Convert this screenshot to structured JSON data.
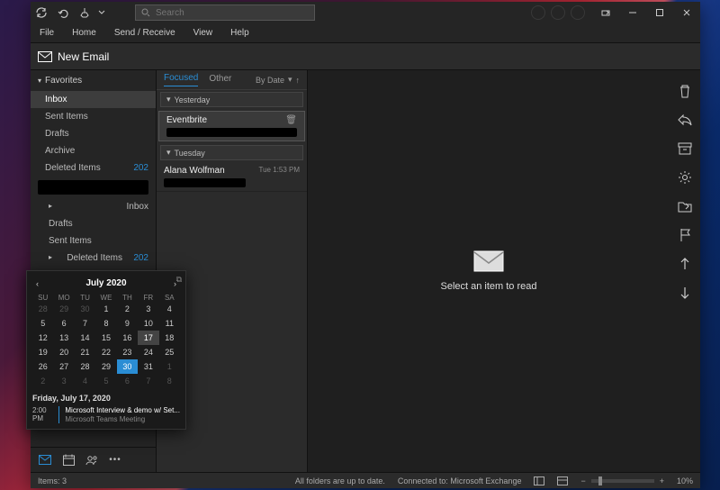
{
  "search": {
    "placeholder": "Search"
  },
  "menus": [
    "File",
    "Home",
    "Send / Receive",
    "View",
    "Help"
  ],
  "ribbon": {
    "new_email": "New Email"
  },
  "nav": {
    "favorites_label": "Favorites",
    "favorites": [
      {
        "name": "Inbox"
      },
      {
        "name": "Sent Items"
      },
      {
        "name": "Drafts"
      },
      {
        "name": "Archive"
      },
      {
        "name": "Deleted Items",
        "count": "202"
      }
    ],
    "account": [
      {
        "name": "Inbox"
      },
      {
        "name": "Drafts"
      },
      {
        "name": "Sent Items"
      },
      {
        "name": "Deleted Items",
        "count": "202"
      }
    ]
  },
  "list": {
    "tabs": [
      "Focused",
      "Other"
    ],
    "sort": "By Date",
    "groups": [
      "Yesterday",
      "Tuesday"
    ],
    "messages": [
      {
        "from": "Eventbrite",
        "time": ""
      },
      {
        "from": "Alana Wolfman",
        "time": "Tue 1:53 PM"
      }
    ]
  },
  "reading": {
    "placeholder": "Select an item to read"
  },
  "status": {
    "items": "Items: 3",
    "sync": "All folders are up to date.",
    "connection": "Connected to: Microsoft Exchange",
    "zoom": "10%"
  },
  "calendar": {
    "month": "July 2020",
    "dow": [
      "SU",
      "MO",
      "TU",
      "WE",
      "TH",
      "FR",
      "SA"
    ],
    "weeks": [
      [
        {
          "d": 28,
          "dim": true
        },
        {
          "d": 29,
          "dim": true
        },
        {
          "d": 30,
          "dim": true
        },
        {
          "d": 1
        },
        {
          "d": 2
        },
        {
          "d": 3
        },
        {
          "d": 4
        }
      ],
      [
        {
          "d": 5
        },
        {
          "d": 6
        },
        {
          "d": 7
        },
        {
          "d": 8
        },
        {
          "d": 9
        },
        {
          "d": 10
        },
        {
          "d": 11
        }
      ],
      [
        {
          "d": 12
        },
        {
          "d": 13
        },
        {
          "d": 14
        },
        {
          "d": 15
        },
        {
          "d": 16
        },
        {
          "d": 17,
          "sel": true
        },
        {
          "d": 18
        }
      ],
      [
        {
          "d": 19
        },
        {
          "d": 20
        },
        {
          "d": 21
        },
        {
          "d": 22
        },
        {
          "d": 23
        },
        {
          "d": 24
        },
        {
          "d": 25
        }
      ],
      [
        {
          "d": 26
        },
        {
          "d": 27
        },
        {
          "d": 28
        },
        {
          "d": 29
        },
        {
          "d": 30,
          "today": true
        },
        {
          "d": 31
        },
        {
          "d": 1,
          "dim": true
        }
      ],
      [
        {
          "d": 2,
          "dim": true
        },
        {
          "d": 3,
          "dim": true
        },
        {
          "d": 4,
          "dim": true
        },
        {
          "d": 5,
          "dim": true
        },
        {
          "d": 6,
          "dim": true
        },
        {
          "d": 7,
          "dim": true
        },
        {
          "d": 8,
          "dim": true
        }
      ]
    ],
    "agenda_date": "Friday, July 17, 2020",
    "agenda": [
      {
        "time": "2:00 PM",
        "title": "Microsoft Interview & demo w/ Set...",
        "location": "Microsoft Teams Meeting"
      }
    ]
  }
}
